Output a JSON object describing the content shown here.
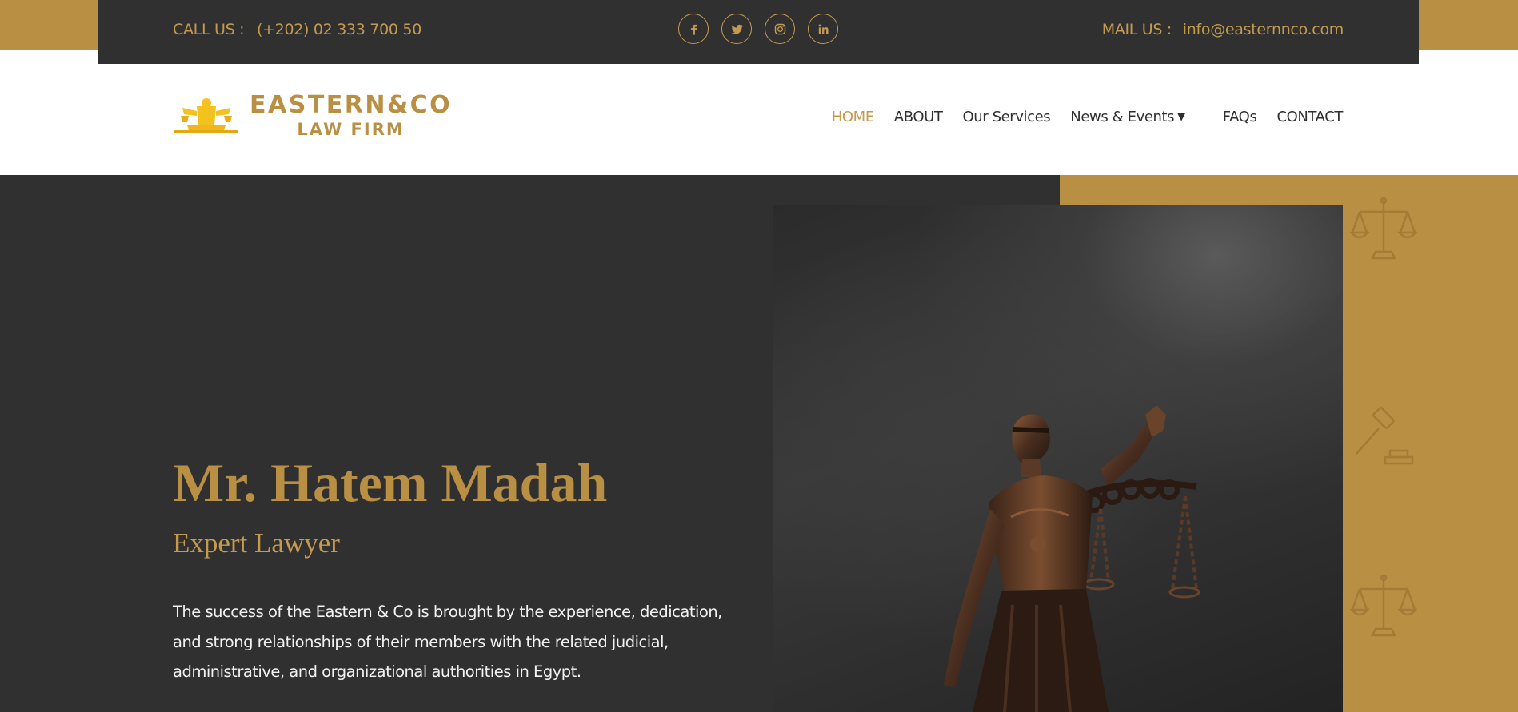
{
  "topbar": {
    "call_label": "CALL US :",
    "call_value": "(+202) 02 333 700 50",
    "mail_label": "MAIL US :",
    "mail_value": "info@easternnco.com",
    "socials": [
      "facebook-icon",
      "twitter-icon",
      "instagram-icon",
      "linkedin-icon"
    ]
  },
  "logo": {
    "line1": "EASTERN&CO",
    "line2": "LAW FIRM"
  },
  "nav": {
    "items": [
      {
        "label": "HOME",
        "active": true
      },
      {
        "label": "ABOUT"
      },
      {
        "label": "Our Services"
      },
      {
        "label": "News & Events",
        "dropdown": true
      },
      {
        "label": "FAQs"
      },
      {
        "label": "CONTACT"
      }
    ]
  },
  "hero": {
    "name": "Mr. Hatem Madah",
    "role": "Expert Lawyer",
    "description": "The success of the Eastern & Co is brought by the experience, dedication, and strong relationships of their members with the related judicial, administrative, and organizational authorities in Egypt.",
    "side_icons": [
      "scales-icon",
      "gavel-icon",
      "scales-icon"
    ]
  },
  "colors": {
    "gold": "#b98f43",
    "dark": "#313031",
    "white": "#ffffff"
  }
}
